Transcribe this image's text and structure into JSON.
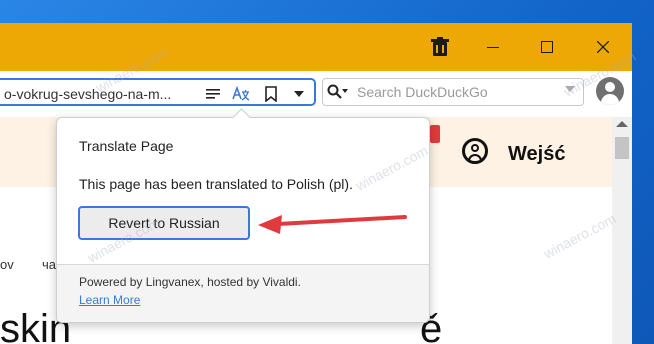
{
  "browser": {
    "url_text": "o-vokrug-sevshego-na-m...",
    "search_placeholder": "Search DuckDuckGo"
  },
  "page": {
    "login_label": "Wejść",
    "fragment_ov": "ov",
    "fragment_cha": "ча",
    "fragment_heading": "skin",
    "fragment_e": "ě"
  },
  "translate_popup": {
    "title": "Translate Page",
    "message": "This page has been translated to Polish (pl).",
    "revert_button": "Revert to Russian",
    "powered_by": "Powered by Lingvanex, hosted by Vivaldi.",
    "learn_more": "Learn More"
  },
  "watermarks": [
    "winaero.com",
    "winaero.com",
    "winaero.com",
    "winaero.com",
    "winaero.com"
  ],
  "colors": {
    "titlebar": "#eea806",
    "accent": "#3b79d8",
    "annotation_arrow": "#e03a3e"
  }
}
